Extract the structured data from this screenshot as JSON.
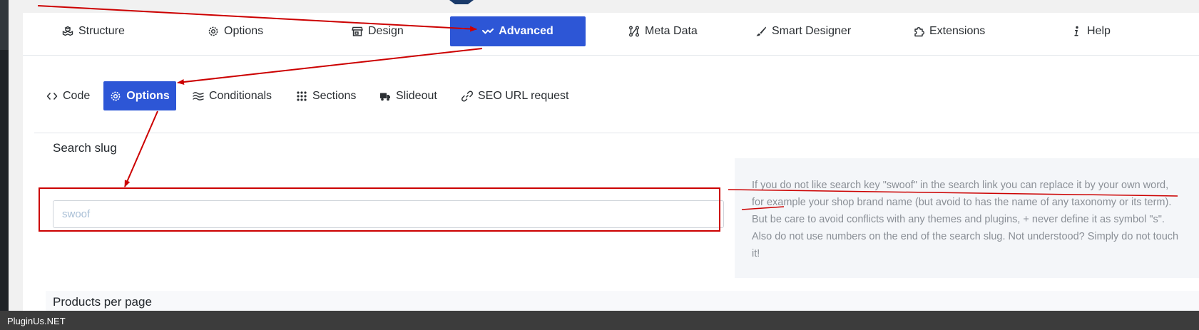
{
  "main_tabs": [
    {
      "label": "Structure",
      "icon": "cubes-icon"
    },
    {
      "label": "Options",
      "icon": "gear-icon"
    },
    {
      "label": "Design",
      "icon": "store-icon"
    },
    {
      "label": "Advanced",
      "icon": "wave-icon",
      "active": true
    },
    {
      "label": "Meta Data",
      "icon": "nodes-icon"
    },
    {
      "label": "Smart Designer",
      "icon": "brush-icon"
    },
    {
      "label": "Extensions",
      "icon": "puzzle-icon"
    },
    {
      "label": "Help",
      "icon": "info-icon"
    }
  ],
  "sub_tabs": [
    {
      "label": "Code",
      "icon": "code-icon"
    },
    {
      "label": "Options",
      "icon": "gear-icon",
      "active": true
    },
    {
      "label": "Conditionals",
      "icon": "wave-lines-icon"
    },
    {
      "label": "Sections",
      "icon": "grid-icon"
    },
    {
      "label": "Slideout",
      "icon": "truck-icon"
    },
    {
      "label": "SEO URL request",
      "icon": "link-icon"
    }
  ],
  "search_slug": {
    "title": "Search slug",
    "value": "",
    "placeholder": "swoof",
    "help_text": "If you do not like search key \"swoof\" in the search link you can replace it by your own word, for example your shop brand name (but avoid to has the name of any taxonomy or its term). But be care to avoid conflicts with any themes and plugins, + never define it as symbol \"s\". Also do not use numbers on the end of the search slug. Not understood? Simply do not touch it!"
  },
  "next_section": {
    "title": "Products per page"
  },
  "status_bar": {
    "text": "PluginUs.NET"
  },
  "colors": {
    "accent": "#2d56d6",
    "annotation": "#cc0000",
    "status_bar": "#3c3c3c"
  }
}
